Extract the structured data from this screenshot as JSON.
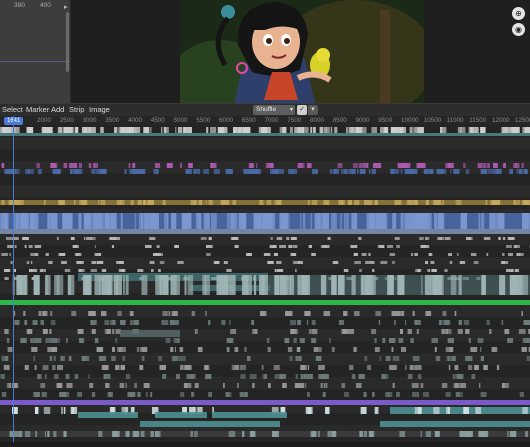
{
  "graph": {
    "ticks": [
      "380",
      "400"
    ]
  },
  "side_buttons": [
    "zoom-icon",
    "camera-icon"
  ],
  "menubar": {
    "items": [
      "Select",
      "Marker",
      "Add",
      "Strip",
      "Image"
    ],
    "shuffle_label": "Shuffle"
  },
  "ruler": {
    "current_frame": "1641",
    "ticks": [
      "2000",
      "2500",
      "3000",
      "3500",
      "4000",
      "4500",
      "5000",
      "5500",
      "6000",
      "6500",
      "7000",
      "7500",
      "8000",
      "8500",
      "9000",
      "9500",
      "10000",
      "10500",
      "11000",
      "11500",
      "12000",
      "12500"
    ]
  },
  "colors": {
    "playhead": "#4a7bd3",
    "green_strip": "#2fb84a",
    "purple_strip": "#7a5ac9",
    "teal_strip": "#4e8f92",
    "gray_strip": "#8c8c8c",
    "olive_strip": "#8f7a3a",
    "blue_strip": "#4a6aa8",
    "magenta_strip": "#b05ab0"
  }
}
